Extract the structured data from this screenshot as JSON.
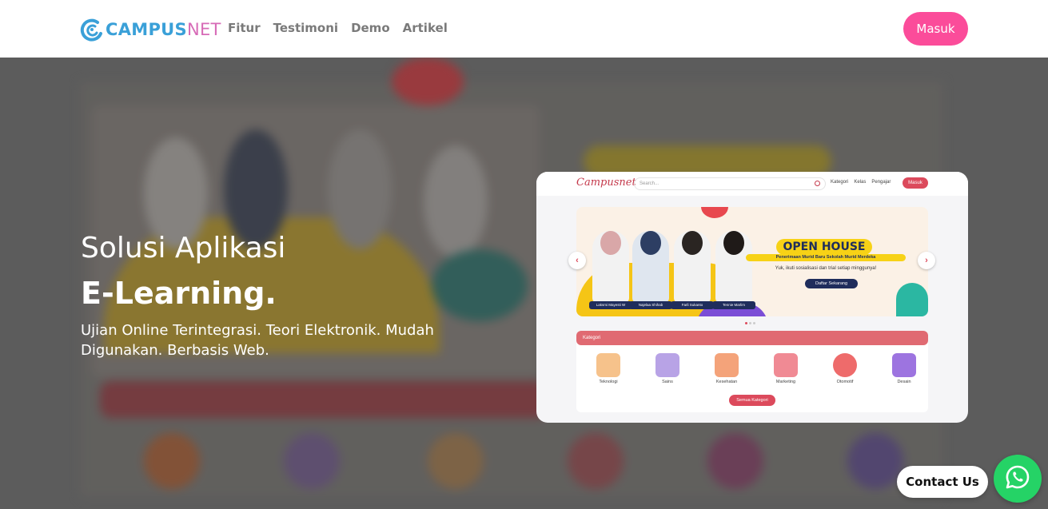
{
  "brand": {
    "logo_part1": "CAMPUS",
    "logo_part2": "NET",
    "logo_colors": {
      "blue": "#3aa0d8",
      "pink": "#d76bb7"
    }
  },
  "nav": {
    "links": [
      "Fitur",
      "Testimoni",
      "Demo",
      "Artikel"
    ],
    "login_label": "Masuk",
    "login_color": "#fb4c9a"
  },
  "hero": {
    "title_line1": "Solusi Aplikasi",
    "title_line2": "E-Learning.",
    "subtitle": "Ujian Online Terintegrasi. Teori Elektronik. Mudah Digunakan. Berbasis Web."
  },
  "preview": {
    "logo": "Campusnet",
    "search_placeholder": "Search...",
    "menu": [
      "Kategori",
      "Kelas",
      "Pengajar"
    ],
    "login_label": "Masuk",
    "banner": {
      "title": "OPEN HOUSE",
      "subtitle": "Penerimaan Murid Baru Sekolah Murid Merdeka",
      "note": "Yuk, ikuti sosialisasi dan trial setiap minggunya!",
      "button": "Daftar Sekarang",
      "people": [
        "Laksmi Mayesti W",
        "Najelaa Shihab",
        "Farli Sukanto",
        "Tennie Marlim"
      ]
    },
    "category_header": "Kategori",
    "categories": [
      "Teknologi",
      "Sains",
      "Kesehatan",
      "Marketing",
      "Otomotif",
      "Desain"
    ],
    "all_categories_button": "Semua Kategori"
  },
  "contact": {
    "label": "Contact Us",
    "icon": "whatsapp-icon",
    "color": "#25d366"
  }
}
